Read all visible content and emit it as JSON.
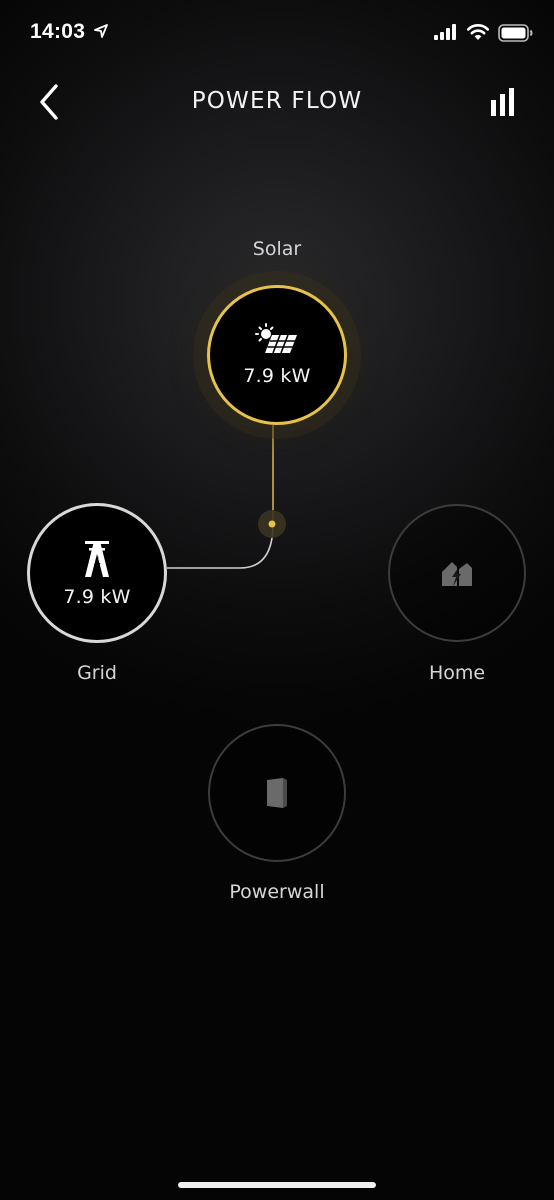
{
  "status_bar": {
    "time": "14:03",
    "icons": [
      "location-arrow-icon",
      "cellular-signal-icon",
      "wifi-icon",
      "battery-icon"
    ]
  },
  "header": {
    "title": "POWER FLOW",
    "back_icon": "chevron-left-icon",
    "stats_icon": "bar-chart-icon"
  },
  "nodes": {
    "solar": {
      "label": "Solar",
      "value": "7.9 kW",
      "icon": "solar-panel-icon",
      "active": true
    },
    "grid": {
      "label": "Grid",
      "value": "7.9 kW",
      "icon": "power-tower-icon",
      "active": true
    },
    "home": {
      "label": "Home",
      "icon": "home-icon",
      "active": false
    },
    "powerwall": {
      "label": "Powerwall",
      "icon": "powerwall-icon",
      "active": false
    }
  },
  "colors": {
    "solar_accent": "#e7c24a",
    "grid_accent": "#d8d8d8",
    "inactive_ring": "#3c3c3c",
    "background": "#000000"
  }
}
